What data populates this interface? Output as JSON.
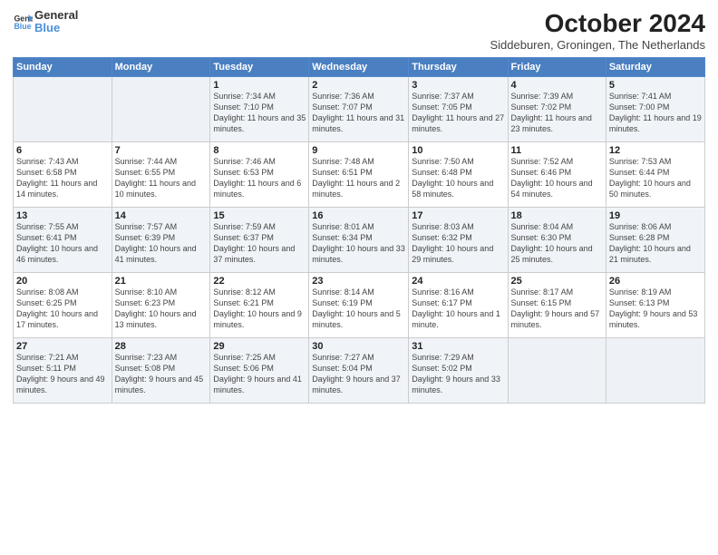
{
  "header": {
    "logo": {
      "line1": "General",
      "line2": "Blue"
    },
    "title": "October 2024",
    "subtitle": "Siddeburen, Groningen, The Netherlands"
  },
  "weekdays": [
    "Sunday",
    "Monday",
    "Tuesday",
    "Wednesday",
    "Thursday",
    "Friday",
    "Saturday"
  ],
  "weeks": [
    [
      {
        "day": "",
        "info": ""
      },
      {
        "day": "",
        "info": ""
      },
      {
        "day": "1",
        "info": "Sunrise: 7:34 AM\nSunset: 7:10 PM\nDaylight: 11 hours and 35 minutes."
      },
      {
        "day": "2",
        "info": "Sunrise: 7:36 AM\nSunset: 7:07 PM\nDaylight: 11 hours and 31 minutes."
      },
      {
        "day": "3",
        "info": "Sunrise: 7:37 AM\nSunset: 7:05 PM\nDaylight: 11 hours and 27 minutes."
      },
      {
        "day": "4",
        "info": "Sunrise: 7:39 AM\nSunset: 7:02 PM\nDaylight: 11 hours and 23 minutes."
      },
      {
        "day": "5",
        "info": "Sunrise: 7:41 AM\nSunset: 7:00 PM\nDaylight: 11 hours and 19 minutes."
      }
    ],
    [
      {
        "day": "6",
        "info": "Sunrise: 7:43 AM\nSunset: 6:58 PM\nDaylight: 11 hours and 14 minutes."
      },
      {
        "day": "7",
        "info": "Sunrise: 7:44 AM\nSunset: 6:55 PM\nDaylight: 11 hours and 10 minutes."
      },
      {
        "day": "8",
        "info": "Sunrise: 7:46 AM\nSunset: 6:53 PM\nDaylight: 11 hours and 6 minutes."
      },
      {
        "day": "9",
        "info": "Sunrise: 7:48 AM\nSunset: 6:51 PM\nDaylight: 11 hours and 2 minutes."
      },
      {
        "day": "10",
        "info": "Sunrise: 7:50 AM\nSunset: 6:48 PM\nDaylight: 10 hours and 58 minutes."
      },
      {
        "day": "11",
        "info": "Sunrise: 7:52 AM\nSunset: 6:46 PM\nDaylight: 10 hours and 54 minutes."
      },
      {
        "day": "12",
        "info": "Sunrise: 7:53 AM\nSunset: 6:44 PM\nDaylight: 10 hours and 50 minutes."
      }
    ],
    [
      {
        "day": "13",
        "info": "Sunrise: 7:55 AM\nSunset: 6:41 PM\nDaylight: 10 hours and 46 minutes."
      },
      {
        "day": "14",
        "info": "Sunrise: 7:57 AM\nSunset: 6:39 PM\nDaylight: 10 hours and 41 minutes."
      },
      {
        "day": "15",
        "info": "Sunrise: 7:59 AM\nSunset: 6:37 PM\nDaylight: 10 hours and 37 minutes."
      },
      {
        "day": "16",
        "info": "Sunrise: 8:01 AM\nSunset: 6:34 PM\nDaylight: 10 hours and 33 minutes."
      },
      {
        "day": "17",
        "info": "Sunrise: 8:03 AM\nSunset: 6:32 PM\nDaylight: 10 hours and 29 minutes."
      },
      {
        "day": "18",
        "info": "Sunrise: 8:04 AM\nSunset: 6:30 PM\nDaylight: 10 hours and 25 minutes."
      },
      {
        "day": "19",
        "info": "Sunrise: 8:06 AM\nSunset: 6:28 PM\nDaylight: 10 hours and 21 minutes."
      }
    ],
    [
      {
        "day": "20",
        "info": "Sunrise: 8:08 AM\nSunset: 6:25 PM\nDaylight: 10 hours and 17 minutes."
      },
      {
        "day": "21",
        "info": "Sunrise: 8:10 AM\nSunset: 6:23 PM\nDaylight: 10 hours and 13 minutes."
      },
      {
        "day": "22",
        "info": "Sunrise: 8:12 AM\nSunset: 6:21 PM\nDaylight: 10 hours and 9 minutes."
      },
      {
        "day": "23",
        "info": "Sunrise: 8:14 AM\nSunset: 6:19 PM\nDaylight: 10 hours and 5 minutes."
      },
      {
        "day": "24",
        "info": "Sunrise: 8:16 AM\nSunset: 6:17 PM\nDaylight: 10 hours and 1 minute."
      },
      {
        "day": "25",
        "info": "Sunrise: 8:17 AM\nSunset: 6:15 PM\nDaylight: 9 hours and 57 minutes."
      },
      {
        "day": "26",
        "info": "Sunrise: 8:19 AM\nSunset: 6:13 PM\nDaylight: 9 hours and 53 minutes."
      }
    ],
    [
      {
        "day": "27",
        "info": "Sunrise: 7:21 AM\nSunset: 5:11 PM\nDaylight: 9 hours and 49 minutes."
      },
      {
        "day": "28",
        "info": "Sunrise: 7:23 AM\nSunset: 5:08 PM\nDaylight: 9 hours and 45 minutes."
      },
      {
        "day": "29",
        "info": "Sunrise: 7:25 AM\nSunset: 5:06 PM\nDaylight: 9 hours and 41 minutes."
      },
      {
        "day": "30",
        "info": "Sunrise: 7:27 AM\nSunset: 5:04 PM\nDaylight: 9 hours and 37 minutes."
      },
      {
        "day": "31",
        "info": "Sunrise: 7:29 AM\nSunset: 5:02 PM\nDaylight: 9 hours and 33 minutes."
      },
      {
        "day": "",
        "info": ""
      },
      {
        "day": "",
        "info": ""
      }
    ]
  ]
}
